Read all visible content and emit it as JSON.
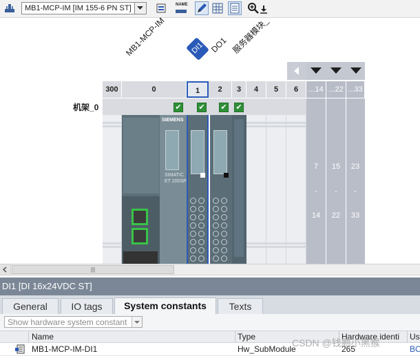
{
  "toolbar": {
    "device_select_value": "MB1-MCP-IM [IM 155-6 PN ST]",
    "name_icon_text": "NAME"
  },
  "device_view": {
    "column_labels": {
      "device_name": "MB1-MCP-IM",
      "slot1_badge": "DI1",
      "slot2_label": "DO1",
      "slot3_label": "服务器模块_"
    },
    "slots": [
      "300",
      "0",
      "1",
      "2",
      "3",
      "4",
      "5",
      "6",
      "...14",
      "...22",
      "...33"
    ],
    "rack_label": "机架_0",
    "extension": {
      "col1": {
        "from": "7",
        "dash": "-",
        "to": "14"
      },
      "col2": {
        "from": "15",
        "dash": "-",
        "to": "22"
      },
      "col3": {
        "from": "23",
        "dash": "-",
        "to": "33"
      }
    },
    "module_text": {
      "vendor": "SIEMENS",
      "brand_line1": "SIMATIC",
      "brand_line2": "ET 200SP"
    },
    "scroll_thumb": "|||"
  },
  "inspector": {
    "title": "DI1 [DI 16x24VDC ST]",
    "tabs": [
      "General",
      "IO tags",
      "System constants",
      "Texts"
    ],
    "filter_placeholder": "Show hardware system constant",
    "table": {
      "headers": [
        "Name",
        "Type",
        "Hardware identi",
        "Use"
      ],
      "rows": [
        {
          "name": "MB1-MCP-IM-DI1",
          "type": "Hw_SubModule",
          "hw_id": "265",
          "use": "BO"
        }
      ]
    }
  },
  "watermark": "CSDN @钱鹏小黑猴",
  "colors": {
    "accent_blue": "#2a5ab8",
    "check_green": "#2f8f38",
    "port_green": "#38c448",
    "inspector_header": "#7b8796",
    "extension_gray": "#b9bdc8"
  }
}
